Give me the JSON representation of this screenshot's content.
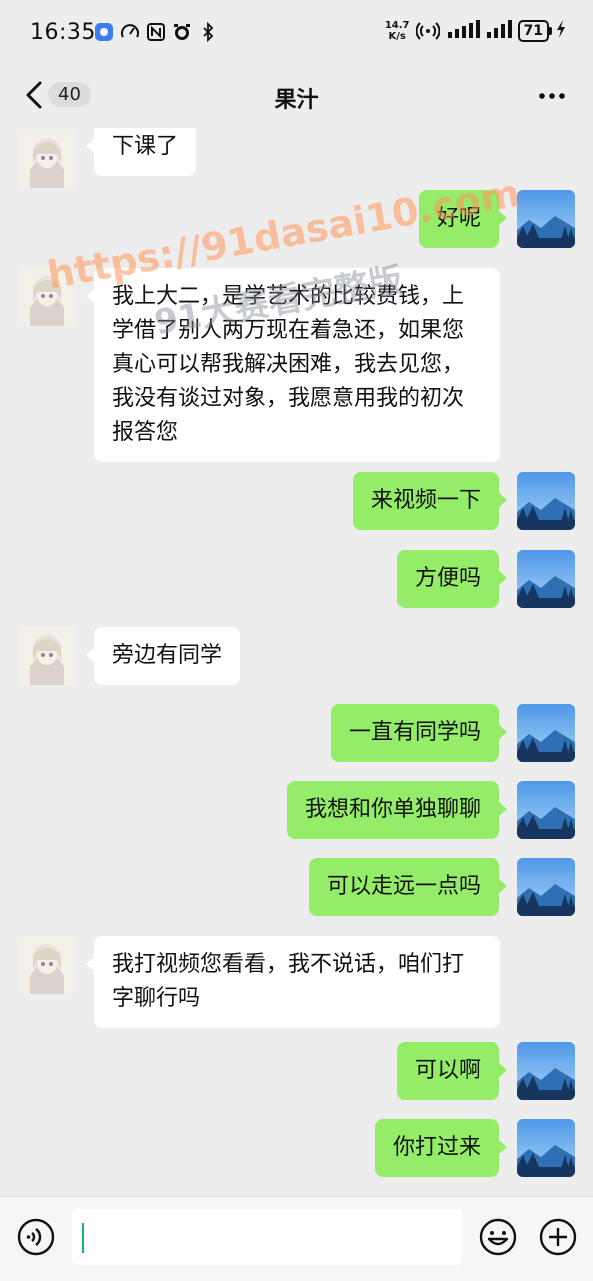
{
  "status_bar": {
    "time": "16:35",
    "net_speed_value": "14.7",
    "net_speed_unit": "K/s",
    "battery": "71"
  },
  "nav": {
    "unread_count": "40",
    "title": "果汁"
  },
  "watermark": {
    "line1": "https://91dasai10.com",
    "line2": "91大赛看完整版"
  },
  "messages": [
    {
      "side": "left",
      "text": "下课了"
    },
    {
      "side": "right",
      "text": "好呢"
    },
    {
      "side": "left",
      "text": "我上大二，是学艺术的比较费钱，上学借了别人两万现在着急还，如果您真心可以帮我解决困难，我去见您，我没有谈过对象，我愿意用我的初次报答您"
    },
    {
      "side": "right",
      "text": "来视频一下"
    },
    {
      "side": "right",
      "text": "方便吗"
    },
    {
      "side": "left",
      "text": "旁边有同学"
    },
    {
      "side": "right",
      "text": "一直有同学吗"
    },
    {
      "side": "right",
      "text": "我想和你单独聊聊"
    },
    {
      "side": "right",
      "text": "可以走远一点吗"
    },
    {
      "side": "left",
      "text": "我打视频您看看，我不说话，咱们打字聊行吗"
    },
    {
      "side": "right",
      "text": "可以啊"
    },
    {
      "side": "right",
      "text": "你打过来"
    }
  ],
  "input": {
    "value": ""
  },
  "colors": {
    "background": "#ededed",
    "self_bubble": "#95ec69",
    "other_bubble": "#ffffff",
    "caret": "#07c160"
  }
}
